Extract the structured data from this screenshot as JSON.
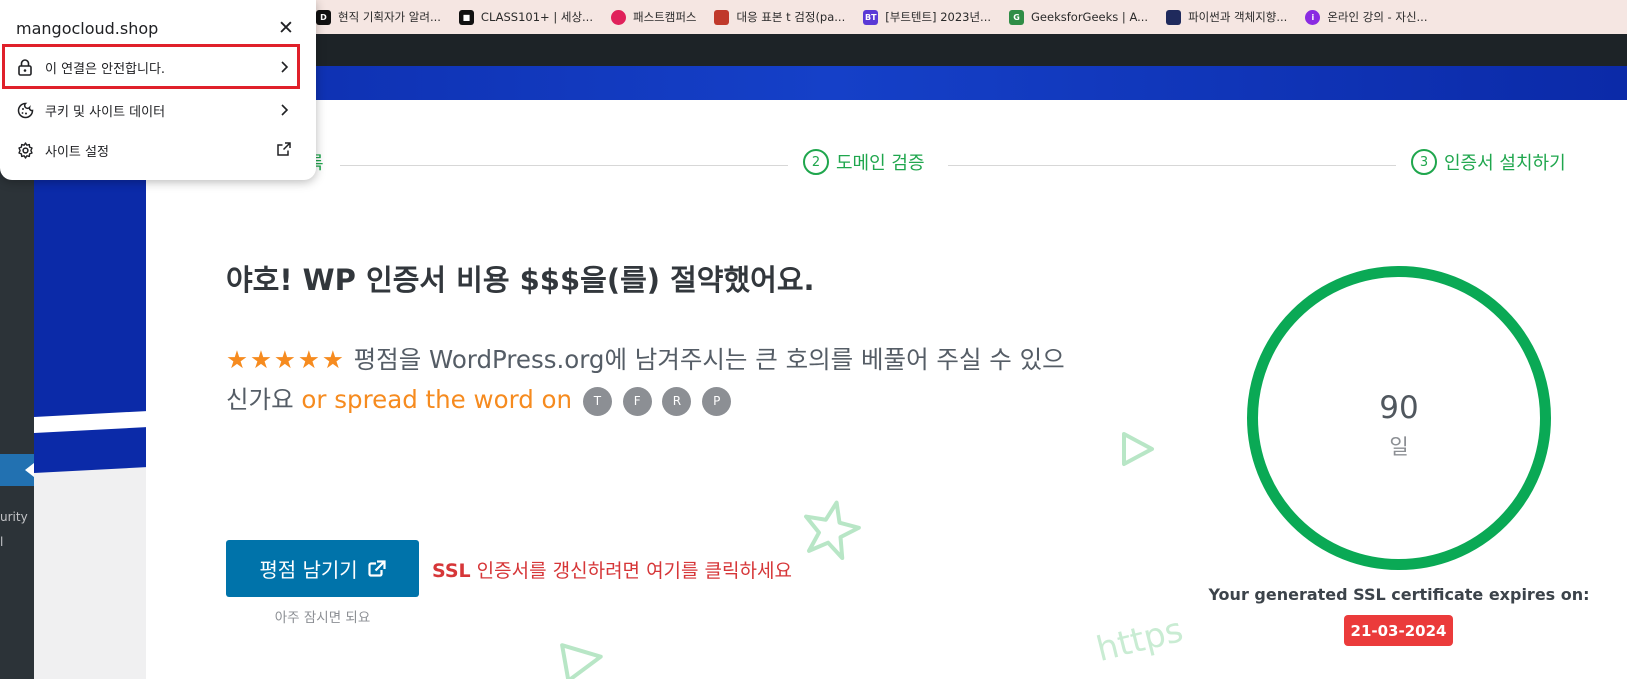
{
  "browser": {
    "bookmarks": [
      {
        "label": "현직 기획자가 알려...",
        "icon": "circle-d-icon",
        "color": "#111111"
      },
      {
        "label": "CLASS101+ | 세상...",
        "icon": "class101-icon",
        "color": "#111111"
      },
      {
        "label": "패스트캠퍼스",
        "icon": "fastcampus-icon",
        "color": "#e0215b"
      },
      {
        "label": "대응 표본 t 검정(pa...",
        "icon": "blog-icon",
        "color": "#c0392b"
      },
      {
        "label": "[부트텐트] 2023년...",
        "icon": "bt-icon",
        "color": "#5a39d6"
      },
      {
        "label": "GeeksforGeeks | A...",
        "icon": "gfg-icon",
        "color": "#2f8d46"
      },
      {
        "label": "파이썬과 객체지향...",
        "icon": "book-icon",
        "color": "#1f2a5c"
      },
      {
        "label": "온라인 강의 - 자신...",
        "icon": "inflearn-icon",
        "color": "#8a2be2"
      }
    ]
  },
  "site_info_popup": {
    "domain": "mangocloud.shop",
    "items": [
      {
        "label": "이 연결은 안전합니다.",
        "icon": "lock-icon"
      },
      {
        "label": "쿠키 및 사이트 데이터",
        "icon": "cookie-icon"
      },
      {
        "label": "사이트 설정",
        "icon": "gear-icon"
      }
    ]
  },
  "wp_sidebar": {
    "partial_items": [
      "urity",
      "l"
    ]
  },
  "steps": {
    "step1_tail": "록",
    "step2": {
      "num": "2",
      "label": "도메인 검증"
    },
    "step3": {
      "num": "3",
      "label": "인증서 설치하기"
    }
  },
  "main": {
    "headline": "야호! WP 인증서 비용 $$$을(를) 절약했어요.",
    "stars": "★★★★★",
    "rating_text": " 평점을 WordPress.org에 남겨주시는 큰 호의를 베풀어 주실 수 있으신가요 ",
    "spread_text": "or spread the word on",
    "social": [
      "T",
      "F",
      "R",
      "P"
    ],
    "rate_button": "평점 남기기",
    "rate_sub": "아주 잠시면 되요",
    "renew_ssl": "SSL",
    "renew_text": " 인증서를 갱신하려면 여기를 클릭하세요",
    "days": "90",
    "days_unit": "일",
    "expire_label": "Your generated SSL certificate expires on:",
    "expire_date": "21-03-2024",
    "deco_text": "https",
    "colors": {
      "accent_green": "#0aa955",
      "button_blue": "#0073aa",
      "star_orange": "#f68b1f",
      "expire_red": "#eb3b3b"
    }
  }
}
